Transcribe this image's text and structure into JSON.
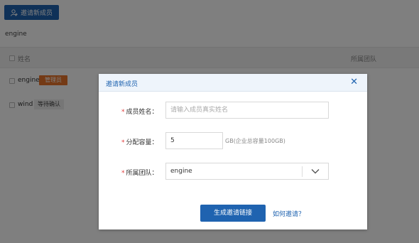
{
  "toolbar": {
    "invite_label": "邀请新成员"
  },
  "team_name": "engine",
  "table": {
    "headers": {
      "name": "姓名",
      "team": "所属团队"
    },
    "rows": [
      {
        "name": "engine",
        "badge": "管理员",
        "badge_type": "admin"
      },
      {
        "name": "wind",
        "badge": "等待确认",
        "badge_type": "pending"
      }
    ]
  },
  "modal": {
    "title": "邀请新成员",
    "close_icon": "close-icon",
    "fields": {
      "name": {
        "label": "成员姓名：",
        "placeholder": "请输入成员真实姓名",
        "value": ""
      },
      "quota": {
        "label": "分配容量：",
        "value": "5",
        "hint": "GB(企业总容量100GB)"
      },
      "team": {
        "label": "所属团队：",
        "value": "engine"
      }
    },
    "generate_label": "生成邀请链接",
    "how_label": "如何邀请？"
  },
  "colors": {
    "primary": "#1f63b0",
    "admin_badge": "#e8742a",
    "required": "#e03a3a"
  }
}
